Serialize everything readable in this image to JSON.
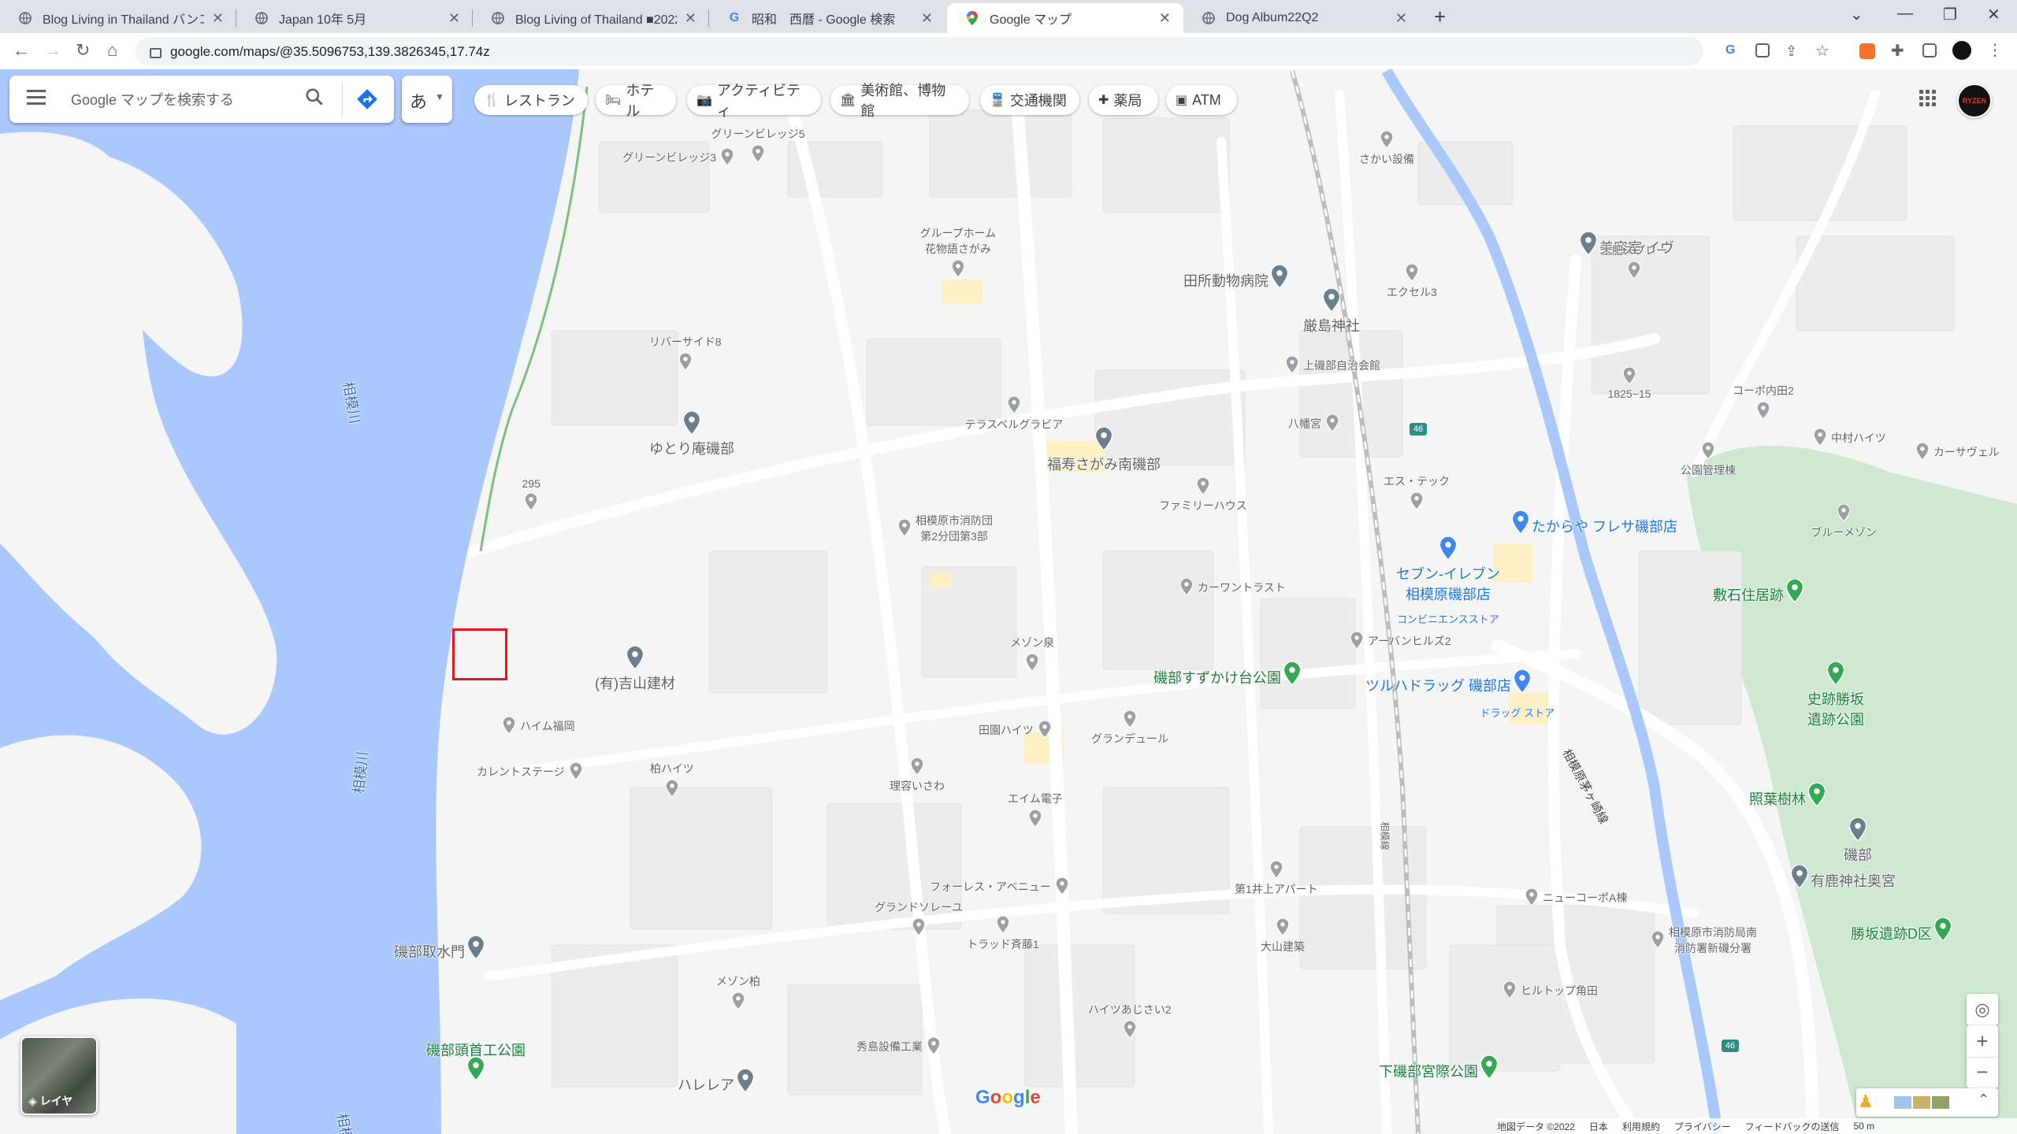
{
  "browser": {
    "tabs": [
      {
        "title": "Blog Living in Thailand バンコクの…",
        "active": false
      },
      {
        "title": "Japan 10年 5月",
        "active": false
      },
      {
        "title": "Blog Living of Thailand ■2022年",
        "active": false
      },
      {
        "title": "昭和　西暦 - Google 検索",
        "active": false
      },
      {
        "title": "Google マップ",
        "active": true
      },
      {
        "title": "Dog Album22Q2",
        "active": false
      }
    ],
    "url": "google.com/maps/@35.5096753,139.3826345,17.74z"
  },
  "search": {
    "placeholder": "Google マップを検索する",
    "input_tool_label": "あ"
  },
  "chips": [
    {
      "label": "レストラン",
      "icon": "restaurant-icon"
    },
    {
      "label": "ホテル",
      "icon": "hotel-icon"
    },
    {
      "label": "アクティビティ",
      "icon": "camera-icon"
    },
    {
      "label": "美術館、博物館",
      "icon": "museum-icon"
    },
    {
      "label": "交通機関",
      "icon": "transit-icon"
    },
    {
      "label": "薬局",
      "icon": "pharmacy-icon"
    },
    {
      "label": "ATM",
      "icon": "atm-icon"
    }
  ],
  "map_labels": {
    "river1": "相模川",
    "river2": "相模川",
    "river3": "相模",
    "road_isobe": "相模原茅ヶ崎線",
    "road_line": "相模線",
    "road_46a": "46",
    "road_46b": "46"
  },
  "pois": [
    {
      "name": "グリーンビレッジ5",
      "kind": "gray"
    },
    {
      "name": "グリーンビレッジ3",
      "kind": "gray"
    },
    {
      "name": "グループホーム\n花物語さがみ",
      "kind": "gray"
    },
    {
      "name": "さかい設備",
      "kind": "gray"
    },
    {
      "name": "美容室 イヴ",
      "kind": "gray-big"
    },
    {
      "name": "土肥スプレー",
      "kind": "gray"
    },
    {
      "name": "田所動物病院",
      "kind": "gray-big"
    },
    {
      "name": "厳島神社",
      "kind": "gray-big"
    },
    {
      "name": "エクセル3",
      "kind": "gray"
    },
    {
      "name": "リバーサイド8",
      "kind": "gray"
    },
    {
      "name": "上磯部自治会館",
      "kind": "gray"
    },
    {
      "name": "1825−15",
      "kind": "gray"
    },
    {
      "name": "コーポ内田2",
      "kind": "gray"
    },
    {
      "name": "テラスベルグラビア",
      "kind": "gray"
    },
    {
      "name": "八幡宮",
      "kind": "gray"
    },
    {
      "name": "ゆとり庵磯部",
      "kind": "gray-big"
    },
    {
      "name": "福寿さがみ南磯部",
      "kind": "gray-big"
    },
    {
      "name": "中村ハイツ",
      "kind": "gray"
    },
    {
      "name": "カーサヴェル",
      "kind": "gray"
    },
    {
      "name": "公園管理棟",
      "kind": "gray"
    },
    {
      "name": "295",
      "kind": "gray"
    },
    {
      "name": "エス・テック",
      "kind": "gray"
    },
    {
      "name": "ファミリーハウス",
      "kind": "gray"
    },
    {
      "name": "相模原市消防団\n第2分団第3部",
      "kind": "gray"
    },
    {
      "name": "たからや フレサ磯部店",
      "kind": "blue"
    },
    {
      "name": "ブルーメゾン",
      "kind": "gray"
    },
    {
      "name": "セブン-イレブン\n相模原磯部店",
      "kind": "blue"
    },
    {
      "name": "コンビニエンスストア",
      "kind": "sub"
    },
    {
      "name": "カーワントラスト",
      "kind": "gray"
    },
    {
      "name": "敷石住居跡",
      "kind": "green"
    },
    {
      "name": "アーバンヒルズ2",
      "kind": "gray"
    },
    {
      "name": "メゾン泉",
      "kind": "gray"
    },
    {
      "name": "(有)吉山建材",
      "kind": "gray-big"
    },
    {
      "name": "磯部すずかけ台公園",
      "kind": "green"
    },
    {
      "name": "史跡勝坂\n遺跡公園",
      "kind": "green"
    },
    {
      "name": "ツルハドラッグ 磯部店",
      "kind": "blue"
    },
    {
      "name": "ドラッグ ストア",
      "kind": "sub"
    },
    {
      "name": "ハイム福岡",
      "kind": "gray"
    },
    {
      "name": "田園ハイツ",
      "kind": "gray"
    },
    {
      "name": "グランデュール",
      "kind": "gray"
    },
    {
      "name": "カレントステージ",
      "kind": "gray"
    },
    {
      "name": "柏ハイツ",
      "kind": "gray"
    },
    {
      "name": "理容いさわ",
      "kind": "gray"
    },
    {
      "name": "エイム電子",
      "kind": "gray"
    },
    {
      "name": "照葉樹林",
      "kind": "green"
    },
    {
      "name": "磯部",
      "kind": "gray-big"
    },
    {
      "name": "第1井上アパート",
      "kind": "gray"
    },
    {
      "name": "フォーレス・アベニュー",
      "kind": "gray"
    },
    {
      "name": "有鹿神社奥宮",
      "kind": "gray-big"
    },
    {
      "name": "ニューコーポA棟",
      "kind": "gray"
    },
    {
      "name": "グランドソレーユ",
      "kind": "gray"
    },
    {
      "name": "トラッド斉藤1",
      "kind": "gray"
    },
    {
      "name": "大山建築",
      "kind": "gray"
    },
    {
      "name": "相模原市消防局南\n消防署新磯分署",
      "kind": "gray"
    },
    {
      "name": "勝坂遺跡D区",
      "kind": "green"
    },
    {
      "name": "磯部取水門",
      "kind": "gray-big"
    },
    {
      "name": "メゾン柏",
      "kind": "gray"
    },
    {
      "name": "ヒルトップ角田",
      "kind": "gray"
    },
    {
      "name": "ハイツあじさい2",
      "kind": "gray"
    },
    {
      "name": "磯部頭首工公園",
      "kind": "green"
    },
    {
      "name": "秀島設備工業",
      "kind": "gray"
    },
    {
      "name": "下磯部宮際公園",
      "kind": "green"
    },
    {
      "name": "ハレレア",
      "kind": "gray-big"
    }
  ],
  "layer_label": "レイヤ",
  "google_logo": "Google",
  "footer": [
    "地図データ ©2022",
    "日本",
    "利用規約",
    "プライバシー",
    "フィードバックの送信",
    "50 m"
  ],
  "colors": {
    "water": "#aac8fb",
    "park": "#c8e6c9",
    "accent": "#1a73e8"
  }
}
